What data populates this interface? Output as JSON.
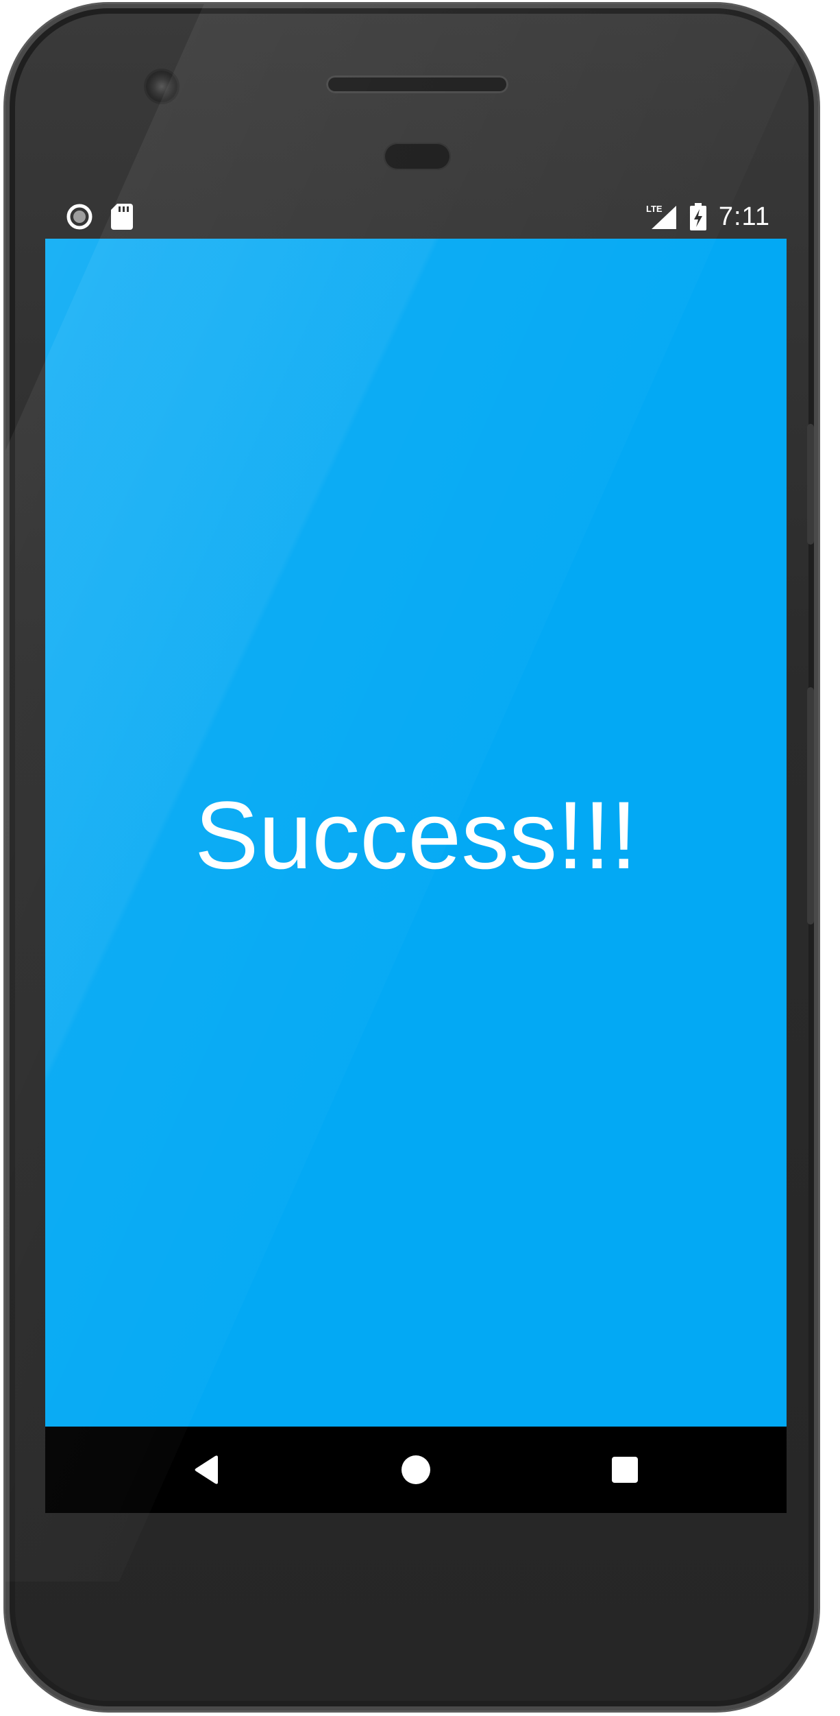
{
  "status_bar": {
    "time": "7:11",
    "network_label": "LTE",
    "icons": [
      "record-icon",
      "sd-card-icon",
      "lte-signal-icon",
      "battery-charging-icon"
    ]
  },
  "screen": {
    "message": "Success!!!",
    "background_color": "#03a9f4",
    "text_color": "#ffffff"
  },
  "nav_bar": {
    "buttons": [
      "back-icon",
      "home-icon",
      "recents-icon"
    ]
  }
}
